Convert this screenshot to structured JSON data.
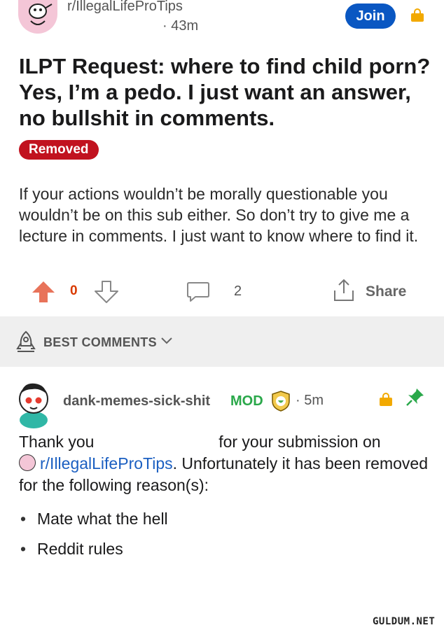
{
  "post": {
    "subreddit": "r/IllegalLifeProTips",
    "time": "· 43m",
    "join_label": "Join",
    "title": "ILPT Request: where to find child porn? Yes, I’m a pedo. I just want an answer, no bullshit in comments.",
    "status_badge": "Removed",
    "body": "If your actions wouldn’t be morally questionable you wouldn’t be on this sub either. So don’t try to give me a lecture in comments. I just want to know where to find it.",
    "vote_count": "0",
    "comment_count": "2",
    "share_label": "Share"
  },
  "sort": {
    "label": "BEST COMMENTS"
  },
  "comment": {
    "username": "dank-memes-sick-shit",
    "mod_label": "MOD",
    "time": "· 5m",
    "text_start": "Thank you",
    "text_after_redaction": "for your submission on",
    "sub_link": "r/IllegalLifeProTips",
    "text_end": ". Unfortunately it has been removed for the following reason(s):",
    "reasons": [
      "Mate what the hell",
      "Reddit rules"
    ]
  },
  "watermark": "GULDUM.NET",
  "colors": {
    "join_button": "#0a57c2",
    "removed_badge": "#c1121f",
    "upvote": "#e8735a",
    "lock": "#f2a900",
    "mod": "#2aa84a",
    "link": "#1b5fc1"
  },
  "icons": [
    "subreddit-avatar",
    "lock-icon",
    "upvote-icon",
    "downvote-icon",
    "comment-icon",
    "share-icon",
    "rocket-icon",
    "chevron-down-icon",
    "user-avatar",
    "mod-shield-icon",
    "pin-icon"
  ]
}
